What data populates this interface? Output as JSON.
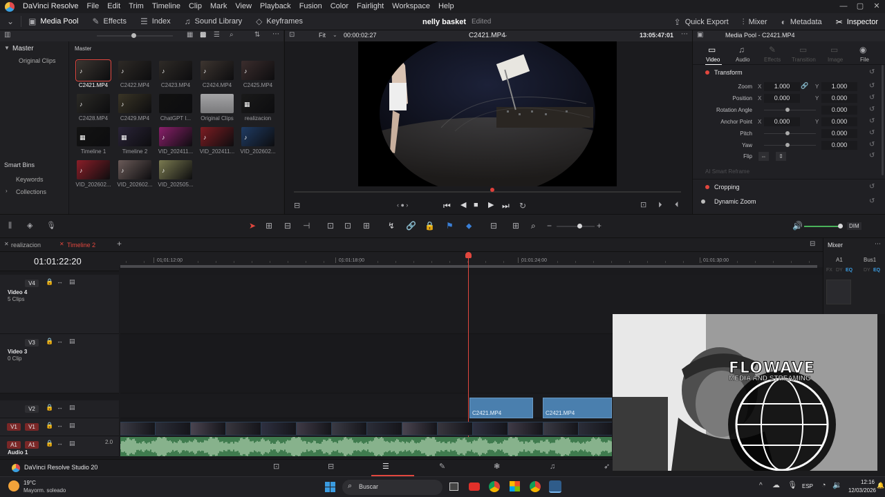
{
  "app": {
    "name": "DaVinci Resolve",
    "project": "nelly basket",
    "project_status": "Edited"
  },
  "menu": [
    "File",
    "Edit",
    "Trim",
    "Timeline",
    "Clip",
    "Mark",
    "View",
    "Playback",
    "Fusion",
    "Color",
    "Fairlight",
    "Workspace",
    "Help"
  ],
  "toolbar": {
    "left": [
      {
        "label": "Media Pool",
        "icon": "media-pool-icon"
      },
      {
        "label": "Effects",
        "icon": "effects-icon"
      },
      {
        "label": "Index",
        "icon": "index-icon"
      },
      {
        "label": "Sound Library",
        "icon": "sound-library-icon"
      },
      {
        "label": "Keyframes",
        "icon": "keyframes-icon"
      }
    ],
    "right": [
      {
        "label": "Quick Export",
        "icon": "quick-export-icon"
      },
      {
        "label": "Mixer",
        "icon": "mixer-icon"
      },
      {
        "label": "Metadata",
        "icon": "metadata-icon"
      },
      {
        "label": "Inspector",
        "icon": "inspector-icon"
      }
    ]
  },
  "mediapool": {
    "sidebar": {
      "master": "Master",
      "original_clips": "Original Clips",
      "smart_bins": "Smart Bins",
      "keywords": "Keywords",
      "collections": "Collections"
    },
    "bin_title": "Master",
    "clips": [
      {
        "name": "C2421.MP4",
        "kind": "audio",
        "color": "#3a3530"
      },
      {
        "name": "C2422.MP4",
        "kind": "audio",
        "color": "#2e2a26"
      },
      {
        "name": "C2423.MP4",
        "kind": "audio",
        "color": "#2f2b27"
      },
      {
        "name": "C2424.MP4",
        "kind": "audio",
        "color": "#3d3530"
      },
      {
        "name": "C2425.MP4",
        "kind": "audio",
        "color": "#3b2d2d"
      },
      {
        "name": "C2428.MP4",
        "kind": "audio",
        "color": "#2b2a26"
      },
      {
        "name": "C2429.MP4",
        "kind": "audio",
        "color": "#3a3526"
      },
      {
        "name": "ChatGPT I...",
        "kind": "image",
        "color": "#111111"
      },
      {
        "name": "Original Clips",
        "kind": "folder",
        "color": "#8a8a8d"
      },
      {
        "name": "realizacion",
        "kind": "timeline",
        "color": "#1a1a1a"
      },
      {
        "name": "Timeline 1",
        "kind": "timeline",
        "color": "#131313"
      },
      {
        "name": "Timeline 2",
        "kind": "timeline",
        "color": "#2a2438"
      },
      {
        "name": "VID_202411...",
        "kind": "audio",
        "color": "#8a1f6a"
      },
      {
        "name": "VID_202411...",
        "kind": "audio",
        "color": "#7d1c22"
      },
      {
        "name": "VID_202602...",
        "kind": "audio",
        "color": "#1f3b63"
      },
      {
        "name": "VID_202602...",
        "kind": "audio",
        "color": "#8a1e28"
      },
      {
        "name": "VID_202602...",
        "kind": "audio",
        "color": "#6a5a58"
      },
      {
        "name": "VID_202505...",
        "kind": "audio",
        "color": "#7a7a50"
      }
    ]
  },
  "viewer": {
    "fit": "Fit",
    "duration": "00:00:02:27",
    "clip": "C2421.MP4",
    "timecode": "13:05:47:01"
  },
  "inspector": {
    "header": "Media Pool - C2421.MP4",
    "tabs": [
      "Video",
      "Audio",
      "Effects",
      "Transition",
      "Image",
      "File"
    ],
    "transform": "Transform",
    "rows": [
      {
        "label": "Zoom",
        "x": "1.000",
        "y": "1.000"
      },
      {
        "label": "Position",
        "x": "0.000",
        "y": "0.000"
      },
      {
        "label": "Rotation Angle",
        "v": "0.000"
      },
      {
        "label": "Anchor Point",
        "x": "0.000",
        "y": "0.000"
      },
      {
        "label": "Pitch",
        "v": "0.000"
      },
      {
        "label": "Yaw",
        "v": "0.000"
      }
    ],
    "flip": "Flip",
    "smart_reframe": "AI Smart Reframe",
    "cropping": "Cropping",
    "dynamic_zoom": "Dynamic Zoom"
  },
  "timeline": {
    "tabs": [
      "realizacion",
      "Timeline 2"
    ],
    "timecode": "01:01:22:20",
    "ruler": [
      "01:01:12:00",
      "01:01:18:00",
      "01:01:24:00",
      "01:01:30:00"
    ],
    "tracks": [
      {
        "tag": "V4",
        "name": "Video 4",
        "sub": "5 Clips"
      },
      {
        "tag": "V3",
        "name": "Video 3",
        "sub": "0 Clip"
      },
      {
        "tag": "V2",
        "name": "",
        "sub": ""
      },
      {
        "tag": "V1",
        "name": "",
        "sub": ""
      },
      {
        "tag": "A1",
        "name": "Audio 1",
        "sub": "2.0"
      }
    ],
    "clips_v2": [
      "C2421.MP4",
      "C2421.MP4"
    ],
    "dim": "DIM"
  },
  "mixer": {
    "title": "Mixer",
    "a1": "A1",
    "bus1": "Bus1",
    "fx": "FX",
    "dy": "DY",
    "eq": "EQ"
  },
  "overlay": {
    "brand_line1": "FLOWAVE",
    "brand_line2": "MEDIA AND STREAMING"
  },
  "bottom": {
    "title": "DaVinci Resolve Studio 20"
  },
  "taskbar": {
    "temp": "19°C",
    "weather": "Mayorm. soleado",
    "search": "Buscar",
    "lang": "ESP",
    "time": "12:16",
    "date": "12/03/2026"
  }
}
